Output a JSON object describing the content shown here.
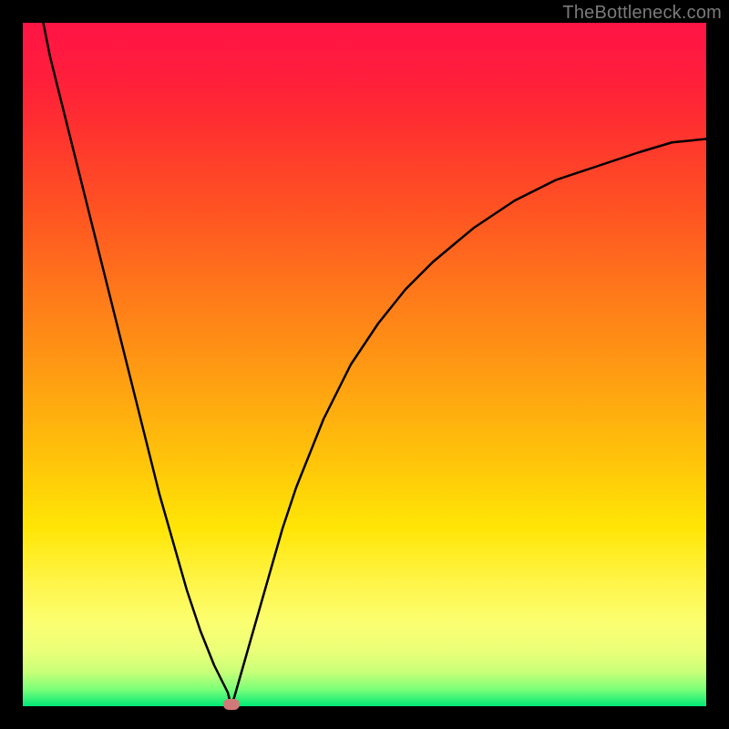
{
  "watermark": {
    "text": "TheBottleneck.com"
  },
  "chart_data": {
    "type": "line",
    "title": "",
    "xlabel": "",
    "ylabel": "",
    "x": [
      0.0,
      0.02,
      0.04,
      0.06,
      0.08,
      0.1,
      0.12,
      0.14,
      0.16,
      0.18,
      0.2,
      0.22,
      0.24,
      0.26,
      0.28,
      0.3,
      0.305,
      0.31,
      0.32,
      0.34,
      0.36,
      0.38,
      0.4,
      0.44,
      0.48,
      0.52,
      0.56,
      0.6,
      0.66,
      0.72,
      0.78,
      0.84,
      0.9,
      0.95,
      1.0
    ],
    "values": [
      1.15,
      1.05,
      0.95,
      0.87,
      0.79,
      0.71,
      0.63,
      0.55,
      0.47,
      0.39,
      0.31,
      0.24,
      0.17,
      0.11,
      0.06,
      0.02,
      0.0,
      0.015,
      0.05,
      0.12,
      0.19,
      0.26,
      0.32,
      0.42,
      0.5,
      0.56,
      0.61,
      0.65,
      0.7,
      0.74,
      0.77,
      0.79,
      0.81,
      0.825,
      0.83
    ],
    "xlim": [
      0,
      1
    ],
    "ylim": [
      0,
      1
    ],
    "min_point": {
      "x": 0.305,
      "y": 0.0
    },
    "grid": false,
    "legend": false,
    "background_gradient": [
      "#ff1444",
      "#ffe606",
      "#00e878"
    ],
    "curve_color": "#000000",
    "marker_color": "#cf7a78"
  }
}
